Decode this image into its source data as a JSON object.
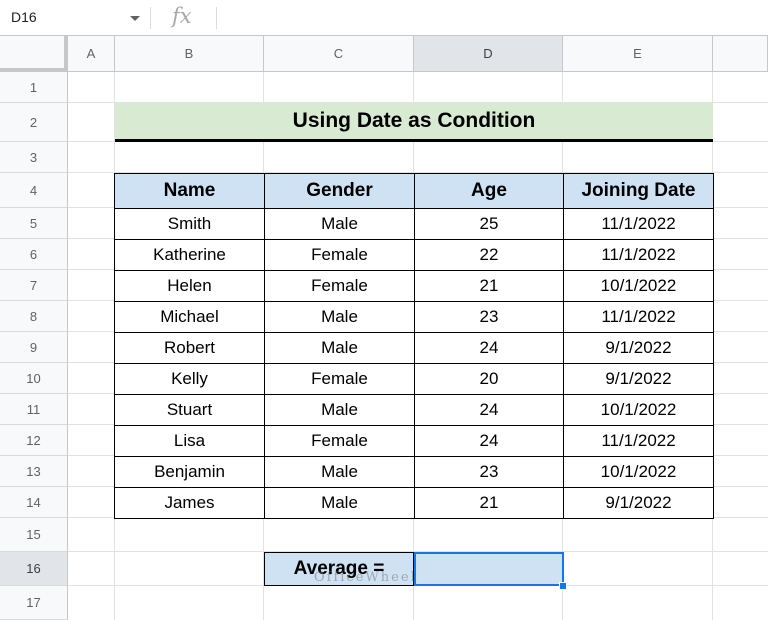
{
  "formula_bar": {
    "cell_ref": "D16",
    "fx_symbol": "fx",
    "formula": ""
  },
  "columns": [
    "A",
    "B",
    "C",
    "D",
    "E"
  ],
  "rows": [
    "1",
    "2",
    "3",
    "4",
    "5",
    "6",
    "7",
    "8",
    "9",
    "10",
    "11",
    "12",
    "13",
    "14",
    "15",
    "16",
    "17"
  ],
  "selected_column": "D",
  "selected_row": "16",
  "title": "Using Date as Condition",
  "table": {
    "headers": [
      "Name",
      "Gender",
      "Age",
      "Joining Date"
    ],
    "rows": [
      [
        "Smith",
        "Male",
        "25",
        "11/1/2022"
      ],
      [
        "Katherine",
        "Female",
        "22",
        "11/1/2022"
      ],
      [
        "Helen",
        "Female",
        "21",
        "10/1/2022"
      ],
      [
        "Michael",
        "Male",
        "23",
        "11/1/2022"
      ],
      [
        "Robert",
        "Male",
        "24",
        "9/1/2022"
      ],
      [
        "Kelly",
        "Female",
        "20",
        "9/1/2022"
      ],
      [
        "Stuart",
        "Male",
        "24",
        "10/1/2022"
      ],
      [
        "Lisa",
        "Female",
        "24",
        "11/1/2022"
      ],
      [
        "Benjamin",
        "Male",
        "23",
        "10/1/2022"
      ],
      [
        "James",
        "Male",
        "21",
        "9/1/2022"
      ]
    ]
  },
  "average": {
    "label": "Average =",
    "value": ""
  },
  "watermark": "OfficeWheel",
  "colors": {
    "title_fill": "#d9ead3",
    "header_fill": "#cfe2f3",
    "selection": "#1a73e8"
  }
}
